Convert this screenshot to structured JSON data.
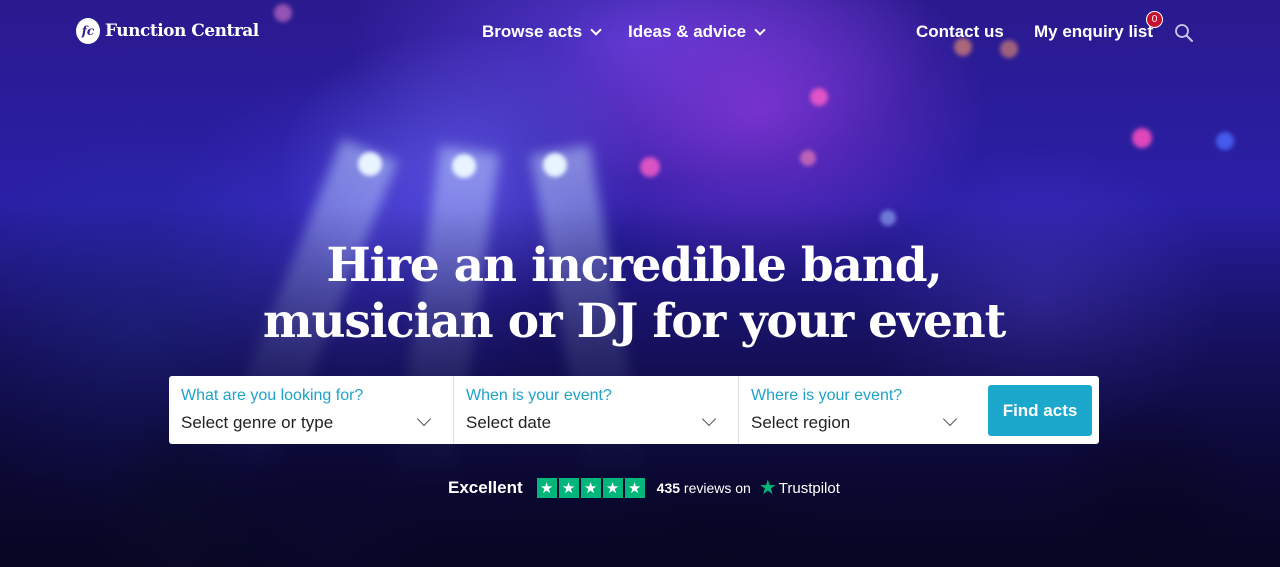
{
  "brand": {
    "logo_mark": "fc",
    "name": "Function Central"
  },
  "nav": {
    "browse_acts": "Browse acts",
    "ideas_advice": "Ideas & advice",
    "contact": "Contact us",
    "enquiry_list": "My enquiry list",
    "enquiry_count": "0"
  },
  "hero": {
    "headline_line1": "Hire an incredible band,",
    "headline_line2": "musician or DJ for your event"
  },
  "search": {
    "genre_label": "What are you looking for?",
    "genre_value": "Select genre or type",
    "date_label": "When is your event?",
    "date_value": "Select date",
    "region_label": "Where is your event?",
    "region_value": "Select region",
    "button": "Find acts"
  },
  "trustpilot": {
    "rating_word": "Excellent",
    "stars": 5,
    "review_count": "435",
    "reviews_suffix": "reviews on",
    "brand": "Trustpilot"
  },
  "colors": {
    "accent": "#1ba8cc",
    "label_blue": "#1fa2c8",
    "trustpilot_green": "#00b67a",
    "badge_red": "#c8102e",
    "hero_bg": "#2a1a8e"
  }
}
